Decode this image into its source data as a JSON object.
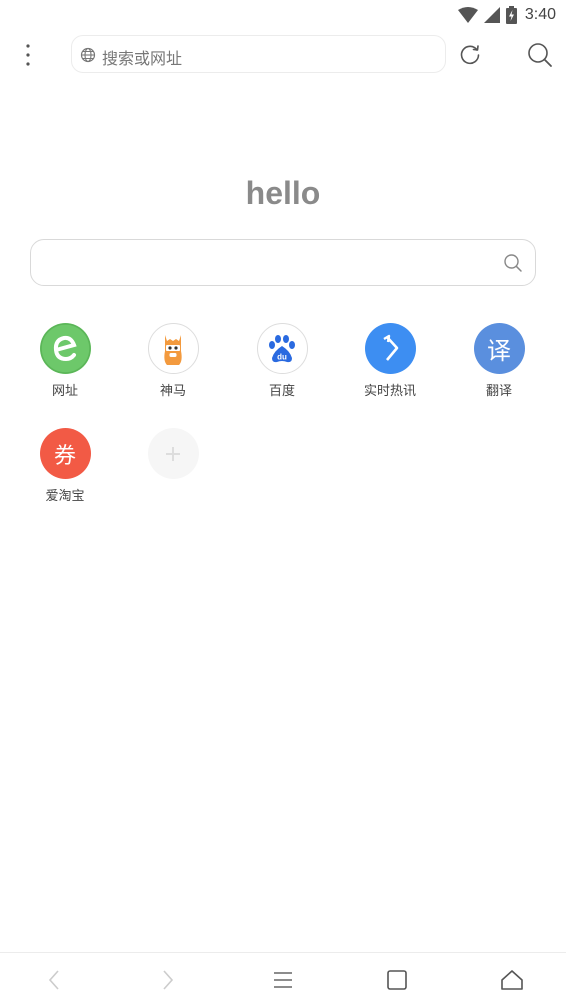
{
  "status_bar": {
    "time": "3:40",
    "icons": [
      "wifi-icon",
      "cell-signal-icon",
      "battery-charging-icon"
    ]
  },
  "toolbar": {
    "menu_icon": "more-vert-icon",
    "url_placeholder": "搜索或网址",
    "globe_icon": "globe-icon",
    "refresh_icon": "refresh-icon",
    "search_icon": "search-icon"
  },
  "home": {
    "logo_text": "hello",
    "search_placeholder": "",
    "search_icon": "search-icon"
  },
  "quick_links": [
    {
      "label": "网址",
      "icon": "e-icon",
      "color": "#6dc86a"
    },
    {
      "label": "神马",
      "icon": "alpaca-icon",
      "color": "#ffffff"
    },
    {
      "label": "百度",
      "icon": "baidu-paw-icon",
      "color": "#ffffff"
    },
    {
      "label": "实时热讯",
      "icon": "arrow-icon",
      "color": "#3d8ef2"
    },
    {
      "label": "翻译",
      "icon_text": "译",
      "color": "#5a8fde"
    },
    {
      "label": "爱淘宝",
      "icon_text": "券",
      "color": "#f25a45"
    },
    {
      "label": "",
      "icon": "add-icon",
      "color": "#f6f6f6"
    }
  ],
  "bottom_nav": [
    "back-icon",
    "forward-icon",
    "menu-lines-icon",
    "tabs-square-icon",
    "home-icon"
  ]
}
